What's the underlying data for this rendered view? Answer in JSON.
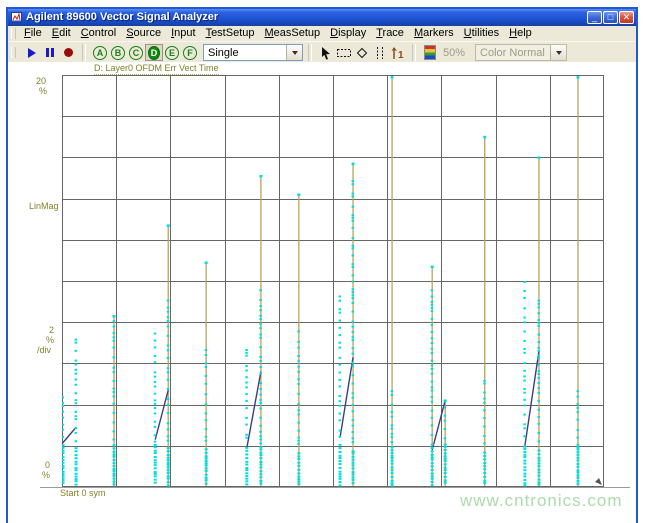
{
  "window": {
    "title": "Agilent 89600 Vector Signal Analyzer",
    "controls": {
      "minimize": "_",
      "maximize": "□",
      "close": "✕"
    }
  },
  "menu": {
    "items": [
      "File",
      "Edit",
      "Control",
      "Source",
      "Input",
      "TestSetup",
      "MeasSetup",
      "Display",
      "Trace",
      "Markers",
      "Utilities",
      "Help"
    ]
  },
  "toolbar": {
    "trace_buttons": [
      "A",
      "B",
      "C",
      "D",
      "E",
      "F"
    ],
    "active_trace": "D",
    "sweep_mode": "Single",
    "zoom_level": "50%",
    "color_mode": "Color Normal",
    "icons": {
      "transport": [
        "play-icon",
        "pause-icon",
        "record-icon"
      ],
      "trace_select": "circled-letter-trace-buttons",
      "mouse_tools": [
        "pointer-icon",
        "selection-box-icon",
        "marker-diamond-icon",
        "band-markers-icon",
        "offset-marker-1-icon"
      ],
      "display_tools": [
        "color-palette-icon"
      ]
    }
  },
  "chart": {
    "title": "D: Layer0 OFDM Err Vect Time",
    "y_max": "20",
    "y_max_unit": "%",
    "y_axis_name": "LinMag",
    "scale_value": "2",
    "scale_unit": "%",
    "scale_per": "/div",
    "y_min": "0",
    "y_min_unit": "%",
    "x_start": "Start 0 sym"
  },
  "watermark": "www.cntronics.com",
  "chart_data": {
    "type": "scatter",
    "title": "D: Layer0 OFDM Err Vect Time",
    "xlabel": "sym",
    "ylabel": "LinMag (%)",
    "x_start_label": "Start 0 sym",
    "ylim": [
      0,
      20
    ],
    "y_per_div": 2,
    "grid": {
      "cols": 10,
      "rows": 10,
      "on": true
    },
    "legend": "none",
    "colors": {
      "spike_line": "#b3a55c",
      "dots": "#00dede",
      "connector": "#3d3d85",
      "grid": "#666666",
      "label": "#80802a"
    },
    "spikes": [
      {
        "x": 0.0,
        "line_top_pct": null,
        "dots_top_pct": 4.4
      },
      {
        "x": 0.026,
        "line_top_pct": null,
        "dots_top_pct": 7.2
      },
      {
        "x": 0.096,
        "line_top_pct": 8.3,
        "dots_top_pct": 8.1
      },
      {
        "x": 0.172,
        "line_top_pct": null,
        "dots_top_pct": 7.5
      },
      {
        "x": 0.196,
        "line_top_pct": 12.7,
        "dots_top_pct": 9.1
      },
      {
        "x": 0.266,
        "line_top_pct": 10.9,
        "dots_top_pct": 6.7
      },
      {
        "x": 0.341,
        "line_top_pct": null,
        "dots_top_pct": 6.7
      },
      {
        "x": 0.367,
        "line_top_pct": 15.1,
        "dots_top_pct": 9.6
      },
      {
        "x": 0.437,
        "line_top_pct": 14.2,
        "dots_top_pct": 7.6
      },
      {
        "x": 0.513,
        "line_top_pct": null,
        "dots_top_pct": 9.3
      },
      {
        "x": 0.537,
        "line_top_pct": 15.7,
        "dots_top_pct": 14.9
      },
      {
        "x": 0.609,
        "line_top_pct": 19.9,
        "dots_top_pct": 4.7
      },
      {
        "x": 0.683,
        "line_top_pct": 10.7,
        "dots_top_pct": 9.6
      },
      {
        "x": 0.707,
        "line_top_pct": 4.2,
        "dots_top_pct": 4.2
      },
      {
        "x": 0.78,
        "line_top_pct": 17.0,
        "dots_top_pct": 5.2
      },
      {
        "x": 0.854,
        "line_top_pct": null,
        "dots_top_pct": 10.0
      },
      {
        "x": 0.88,
        "line_top_pct": 16.0,
        "dots_top_pct": 9.1
      },
      {
        "x": 0.952,
        "line_top_pct": 19.9,
        "dots_top_pct": 4.7
      }
    ],
    "connectors": [
      {
        "x1": 0.0,
        "y1": 2.1,
        "x2": 0.026,
        "y2": 2.9
      },
      {
        "x1": 0.172,
        "y1": 2.3,
        "x2": 0.196,
        "y2": 4.7
      },
      {
        "x1": 0.341,
        "y1": 1.9,
        "x2": 0.367,
        "y2": 5.6
      },
      {
        "x1": 0.513,
        "y1": 2.4,
        "x2": 0.537,
        "y2": 6.3
      },
      {
        "x1": 0.683,
        "y1": 1.8,
        "x2": 0.707,
        "y2": 4.2
      },
      {
        "x1": 0.854,
        "y1": 2.0,
        "x2": 0.88,
        "y2": 6.6
      }
    ]
  }
}
